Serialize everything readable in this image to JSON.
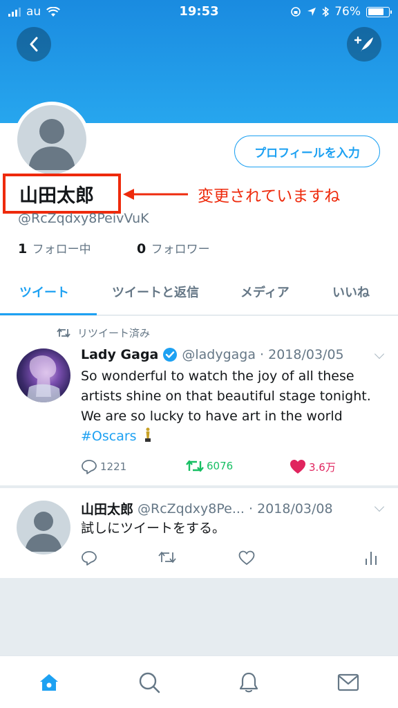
{
  "status_bar": {
    "carrier": "au",
    "time": "19:53",
    "battery": "76%",
    "battery_level": 0.76
  },
  "profile": {
    "edit_button": "プロフィールを入力",
    "name": "山田太郎",
    "annotation": "変更されていますね",
    "handle": "@RcZqdxy8PeivVuK",
    "following_count": "1",
    "following_label": "フォロー中",
    "followers_count": "0",
    "followers_label": "フォロワー"
  },
  "tabs": [
    "ツイート",
    "ツイートと返信",
    "メディア",
    "いいね"
  ],
  "tweets": [
    {
      "retweet_label": "リツイート済み",
      "name": "Lady Gaga",
      "handle_date": "@ladygaga · 2018/03/05",
      "text": "So wonderful to watch the joy of all these artists shine on that beautiful stage tonight. We are so lucky to have art in the world ",
      "hashtag": "#Oscars",
      "replies": "1221",
      "retweets": "6076",
      "likes": "3.6万"
    },
    {
      "name": "山田太郎",
      "handle_date": "@RcZqdxy8Pe... · 2018/03/08",
      "text": "試しにツイートをする。"
    }
  ],
  "colors": {
    "accent": "#1da1f2",
    "annotation": "#ee2a0c",
    "retweet": "#17bf63",
    "like": "#e0245e"
  }
}
